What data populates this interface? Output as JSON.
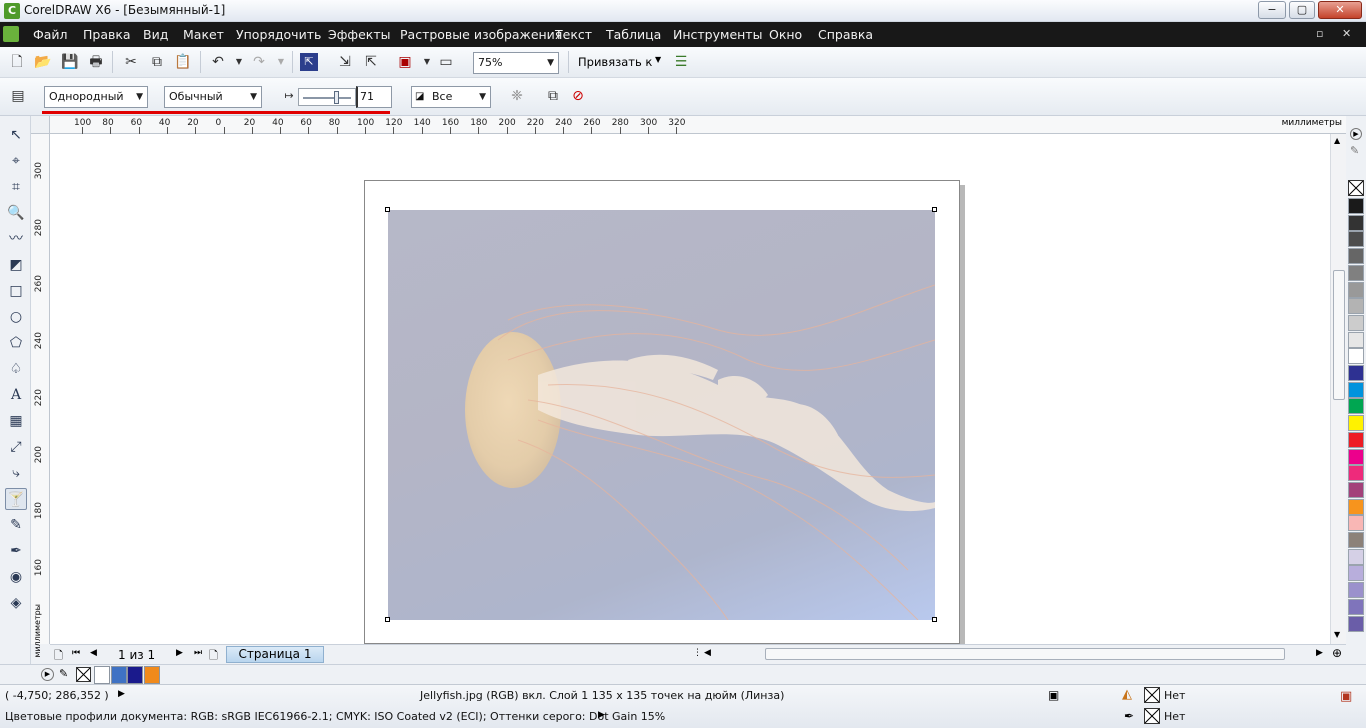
{
  "window": {
    "title": "CorelDRAW X6 - [Безымянный-1]",
    "minimize": "−",
    "maximize": "▢",
    "close": "✕"
  },
  "menu": [
    "Файл",
    "Правка",
    "Вид",
    "Макет",
    "Упорядочить",
    "Эффекты",
    "Растровые изображения",
    "Текст",
    "Таблица",
    "Инструменты",
    "Окно",
    "Справка"
  ],
  "menu_controls": {
    "restore": "▫",
    "close": "✕"
  },
  "standard_toolbar": {
    "zoom": "75%",
    "snap_label": "Привязать к"
  },
  "property_bar": {
    "fill_type": "Однородный",
    "mode": "Обычный",
    "transparency_value": "71",
    "apply_to": "Все"
  },
  "ruler": {
    "unit": "миллиметры",
    "h_ticks": [
      "100",
      "80",
      "60",
      "40",
      "20",
      "0",
      "20",
      "40",
      "60",
      "80",
      "100",
      "120",
      "140",
      "160",
      "180",
      "200",
      "220",
      "240",
      "260",
      "280",
      "300",
      "320"
    ],
    "v_ticks": [
      "300",
      "280",
      "260",
      "240",
      "220",
      "200",
      "180",
      "160"
    ],
    "v_unit": "миллиметры"
  },
  "page_nav": {
    "counter": "1 из 1",
    "tab": "Страница 1"
  },
  "status": {
    "coords": "( -4,750; 286,352 )",
    "object_info": "Jellyfish.jpg (RGB) вкл. Слой 1 135 x 135 точек на дюйм  (Линза)",
    "fill_none": "Нет",
    "outline_none": "Нет",
    "color_profiles": "Цветовые профили документа: RGB: sRGB IEC61966-2.1; CMYK: ISO Coated v2 (ECI); Оттенки серого: Dot Gain 15%"
  },
  "palette_colors": [
    "#1a1a1a",
    "#333333",
    "#4d4d4d",
    "#666666",
    "#808080",
    "#999999",
    "#b3b3b3",
    "#cccccc",
    "#e6e6e6",
    "#ffffff",
    "#2e3192",
    "#0093dd",
    "#00a651",
    "#fff200",
    "#ed1c24",
    "#ec008c",
    "#ee2a7b",
    "#a3417a",
    "#f7941d",
    "#f9b7b5",
    "#8c8179",
    "#d5d0e6",
    "#b8aedc",
    "#9b91cc",
    "#7f74bb",
    "#6a5da8"
  ],
  "doc_palette": [
    "#ffffff",
    "#3f72c4",
    "#1a1a8c",
    "#f08a1c"
  ],
  "icons": {
    "new": "new-document-icon",
    "open": "open-icon",
    "save": "save-icon",
    "print": "print-icon"
  }
}
